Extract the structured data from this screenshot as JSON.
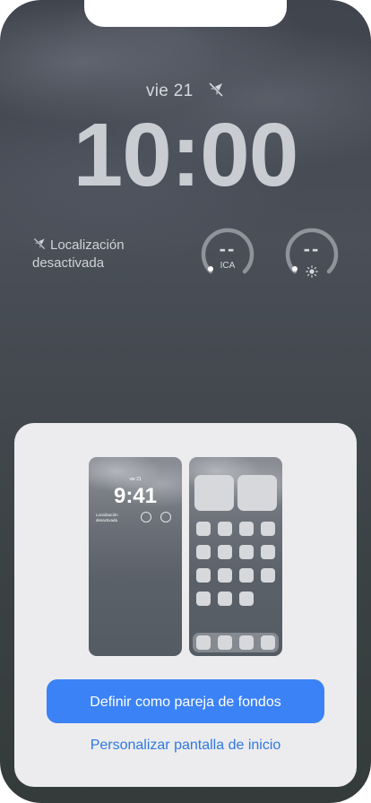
{
  "lock_screen": {
    "date": "vie 21",
    "time": "10:00",
    "location_status": "Localización desactivada",
    "widgets": [
      {
        "value": "--",
        "label": "ICA",
        "icon": "aqi-gauge-icon"
      },
      {
        "value": "--",
        "label": "",
        "icon": "sun-icon"
      }
    ]
  },
  "sheet": {
    "lock_preview": {
      "date": "vie 21",
      "time": "9:41",
      "location_status": "Localización desactivada"
    },
    "primary_button": "Definir como pareja de fondos",
    "secondary_link": "Personalizar pantalla de inicio"
  },
  "colors": {
    "accent": "#3b82f6",
    "link": "#2f78e2",
    "sheet_bg": "#ececef"
  }
}
